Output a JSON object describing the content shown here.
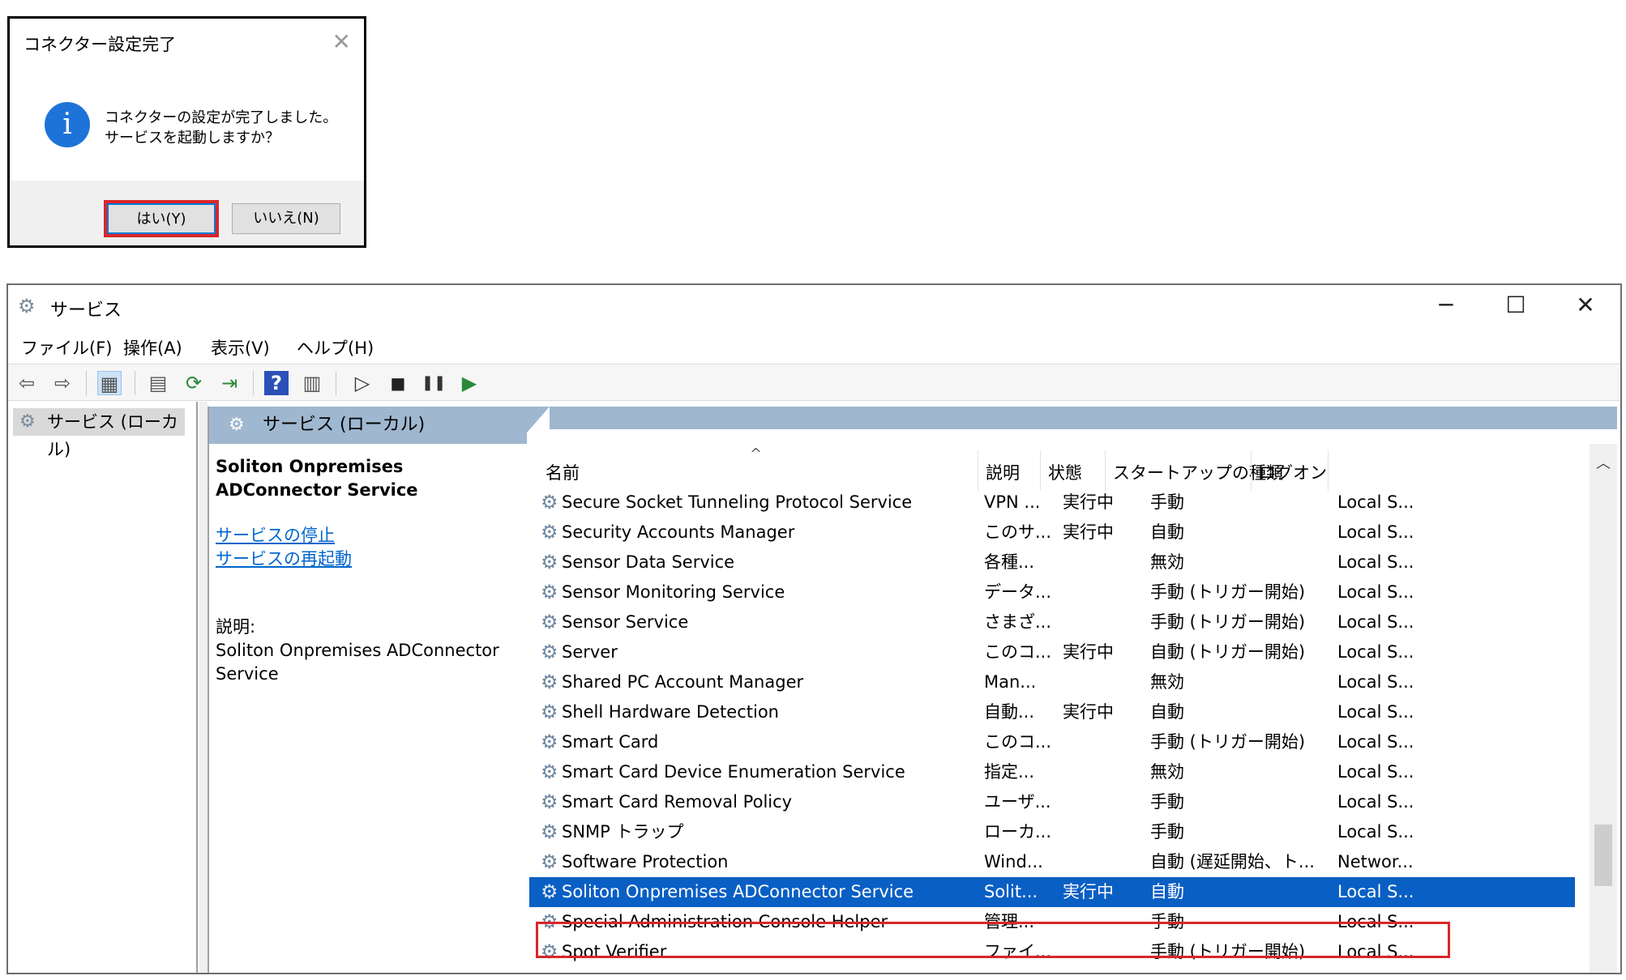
{
  "dialog": {
    "title": "コネクター設定完了",
    "close": "✕",
    "icon": "info-icon",
    "icon_glyph": "i",
    "message_line1": "コネクターの設定が完了しました。",
    "message_line2": "サービスを起動しますか？",
    "yes_label": "はい(Y)",
    "no_label": "いいえ(N)"
  },
  "window": {
    "title": "サービス",
    "title_icon": "gear-icon",
    "minimize": "─",
    "maximize": "☐",
    "close": "✕"
  },
  "menu": [
    "ファイル(F)",
    "操作(A)",
    "表示(V)",
    "ヘルプ(H)"
  ],
  "toolbar": {
    "back": "⇦",
    "forward": "⇨",
    "console_tree": "▦",
    "properties": "▤",
    "refresh": "⟳",
    "export": "⇥",
    "help": "?",
    "view": "▥",
    "start": "▷",
    "stop": "■",
    "pause": "❚❚",
    "resume": "▶"
  },
  "tree": {
    "label": "サービス (ローカル)"
  },
  "content": {
    "header": "サービス (ローカル)",
    "desc_title": "Soliton Onpremises ADConnector Service",
    "link_stop": "サービスの停止",
    "link_restart": "サービスの再起動",
    "desc_label": "説明:",
    "desc_text": "Soliton Onpremises ADConnector Service"
  },
  "list": {
    "sort_caret": "^",
    "columns": {
      "name": "名前",
      "desc": "説明",
      "status": "状態",
      "startup": "スタートアップの種類",
      "logon": "ログオン"
    },
    "rows": [
      {
        "name": "Secure Socket Tunneling Protocol Service",
        "desc": "VPN ...",
        "status": "実行中",
        "startup": "手動",
        "logon": "Local S..."
      },
      {
        "name": "Security Accounts Manager",
        "desc": "このサ...",
        "status": "実行中",
        "startup": "自動",
        "logon": "Local S..."
      },
      {
        "name": "Sensor Data Service",
        "desc": "各種...",
        "status": "",
        "startup": "無効",
        "logon": "Local S..."
      },
      {
        "name": "Sensor Monitoring Service",
        "desc": "データ...",
        "status": "",
        "startup": "手動 (トリガー開始)",
        "logon": "Local S..."
      },
      {
        "name": "Sensor Service",
        "desc": "さまざ...",
        "status": "",
        "startup": "手動 (トリガー開始)",
        "logon": "Local S..."
      },
      {
        "name": "Server",
        "desc": "このコ...",
        "status": "実行中",
        "startup": "自動 (トリガー開始)",
        "logon": "Local S..."
      },
      {
        "name": "Shared PC Account Manager",
        "desc": "Man...",
        "status": "",
        "startup": "無効",
        "logon": "Local S..."
      },
      {
        "name": "Shell Hardware Detection",
        "desc": "自動...",
        "status": "実行中",
        "startup": "自動",
        "logon": "Local S..."
      },
      {
        "name": "Smart Card",
        "desc": "このコ...",
        "status": "",
        "startup": "手動 (トリガー開始)",
        "logon": "Local S..."
      },
      {
        "name": "Smart Card Device Enumeration Service",
        "desc": "指定...",
        "status": "",
        "startup": "無効",
        "logon": "Local S..."
      },
      {
        "name": "Smart Card Removal Policy",
        "desc": "ユーザ...",
        "status": "",
        "startup": "手動",
        "logon": "Local S..."
      },
      {
        "name": "SNMP トラップ",
        "desc": "ローカ...",
        "status": "",
        "startup": "手動",
        "logon": "Local S..."
      },
      {
        "name": "Software Protection",
        "desc": "Wind...",
        "status": "",
        "startup": "自動 (遅延開始、ト...",
        "logon": "Networ..."
      },
      {
        "name": "Soliton Onpremises ADConnector Service",
        "desc": "Solit...",
        "status": "実行中",
        "startup": "自動",
        "logon": "Local S...",
        "selected": true
      },
      {
        "name": "Special Administration Console Helper",
        "desc": "管理...",
        "status": "",
        "startup": "手動",
        "logon": "Local S..."
      },
      {
        "name": "Spot Verifier",
        "desc": "ファイ...",
        "status": "",
        "startup": "手動 (トリガー開始)",
        "logon": "Local S..."
      }
    ]
  },
  "colors": {
    "highlight": "#d9262a",
    "selection": "#0a5fc4",
    "header_band": "#9fb7cf",
    "link": "#0066cc"
  }
}
